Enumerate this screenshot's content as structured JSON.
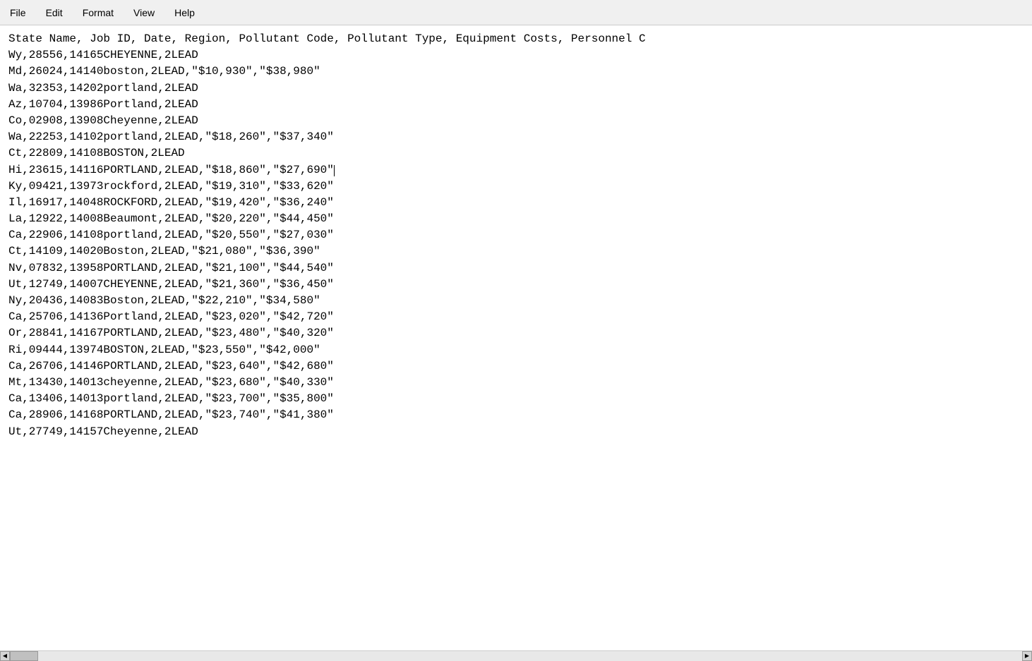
{
  "menu": {
    "items": [
      {
        "label": "File",
        "name": "file-menu"
      },
      {
        "label": "Edit",
        "name": "edit-menu"
      },
      {
        "label": "Format",
        "name": "format-menu"
      },
      {
        "label": "View",
        "name": "view-menu"
      },
      {
        "label": "Help",
        "name": "help-menu"
      }
    ]
  },
  "content": {
    "header": "State Name, Job ID, Date, Region, Pollutant Code, Pollutant Type, Equipment Costs, Personnel C",
    "lines": [
      "Wy,28556,14165CHEYENNE,2LEAD",
      "Md,26024,14140boston,2LEAD,\"$10,930\",\"$38,980\"",
      "Wa,32353,14202portland,2LEAD",
      "Az,10704,13986Portland,2LEAD",
      "Co,02908,13908Cheyenne,2LEAD",
      "Wa,22253,14102portland,2LEAD,\"$18,260\",\"$37,340\"",
      "Ct,22809,14108BOSTON,2LEAD",
      "Hi,23615,14116PORTLAND,2LEAD,\"$18,860\",\"$27,690\"",
      "Ky,09421,13973rockford,2LEAD,\"$19,310\",\"$33,620\"",
      "Il,16917,14048ROCKFORD,2LEAD,\"$19,420\",\"$36,240\"",
      "La,12922,14008Beaumont,2LEAD,\"$20,220\",\"$44,450\"",
      "Ca,22906,14108portland,2LEAD,\"$20,550\",\"$27,030\"",
      "Ct,14109,14020Boston,2LEAD,\"$21,080\",\"$36,390\"",
      "Nv,07832,13958PORTLAND,2LEAD,\"$21,100\",\"$44,540\"",
      "Ut,12749,14007CHEYENNE,2LEAD,\"$21,360\",\"$36,450\"",
      "Ny,20436,14083Boston,2LEAD,\"$22,210\",\"$34,580\"",
      "Ca,25706,14136Portland,2LEAD,\"$23,020\",\"$42,720\"",
      "Or,28841,14167PORTLAND,2LEAD,\"$23,480\",\"$40,320\"",
      "Ri,09444,13974BOSTON,2LEAD,\"$23,550\",\"$42,000\"",
      "Ca,26706,14146PORTLAND,2LEAD,\"$23,640\",\"$42,680\"",
      "Mt,13430,14013cheyenne,2LEAD,\"$23,680\",\"$40,330\"",
      "Ca,13406,14013portland,2LEAD,\"$23,700\",\"$35,800\"",
      "Ca,28906,14168PORTLAND,2LEAD,\"$23,740\",\"$41,380\"",
      "Ut,27749,14157Cheyenne,2LEAD"
    ],
    "cursor_line_index": 7,
    "cursor_after": "Hi,23615,14116PORTLAND,2LEAD,\"$18,860\",\"$27,690\""
  }
}
